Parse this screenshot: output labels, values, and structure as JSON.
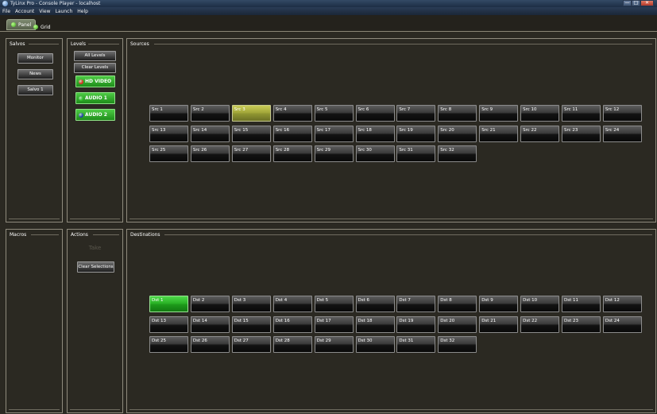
{
  "window": {
    "title": "TyLinx Pro - Console Player - localhost",
    "minimize": "—",
    "maximize": "□",
    "close": "✕"
  },
  "menu": [
    "File",
    "Account",
    "View",
    "Launch",
    "Help"
  ],
  "tabs": {
    "panel": "Panel",
    "grid": "Grid"
  },
  "salvos": {
    "title": "Salvos",
    "buttons": [
      "Monitor",
      "News",
      "Salvo 1"
    ]
  },
  "levels": {
    "title": "Levels",
    "all_levels": "All Levels",
    "clear_levels": "Clear Levels",
    "items": [
      {
        "label": "HD VIDEO",
        "led_color": "#d92b1f"
      },
      {
        "label": "AUDIO 1",
        "led_color": "#2fbd2a"
      },
      {
        "label": "AUDIO 2",
        "led_color": "#1f3fa8"
      }
    ]
  },
  "sources": {
    "title": "Sources",
    "selected": "Src 3",
    "selected_color": "#a4a83a",
    "items": [
      "Src 1",
      "Src 2",
      "Src 3",
      "Src 4",
      "Src 5",
      "Src 6",
      "Src 7",
      "Src 8",
      "Src 9",
      "Src 10",
      "Src 11",
      "Src 12",
      "Src 13",
      "Src 14",
      "Src 15",
      "Src 16",
      "Src 17",
      "Src 18",
      "Src 19",
      "Src 20",
      "Src 21",
      "Src 22",
      "Src 23",
      "Src 24",
      "Src 25",
      "Src 26",
      "Src 27",
      "Src 28",
      "Src 29",
      "Src 30",
      "Src 31",
      "Src 32"
    ]
  },
  "macros": {
    "title": "Macros"
  },
  "actions": {
    "title": "Actions",
    "take": "Take",
    "clear_selections": "Clear Selections"
  },
  "destinations": {
    "title": "Destinations",
    "selected": "Dst 1",
    "selected_color": "#2bb427",
    "items": [
      "Dst 1",
      "Dst 2",
      "Dst 3",
      "Dst 4",
      "Dst 5",
      "Dst 6",
      "Dst 7",
      "Dst 8",
      "Dst 9",
      "Dst 10",
      "Dst 11",
      "Dst 12",
      "Dst 13",
      "Dst 14",
      "Dst 15",
      "Dst 16",
      "Dst 17",
      "Dst 18",
      "Dst 19",
      "Dst 20",
      "Dst 21",
      "Dst 22",
      "Dst 23",
      "Dst 24",
      "Dst 25",
      "Dst 26",
      "Dst 27",
      "Dst 28",
      "Dst 29",
      "Dst 30",
      "Dst 31",
      "Dst 32"
    ]
  }
}
